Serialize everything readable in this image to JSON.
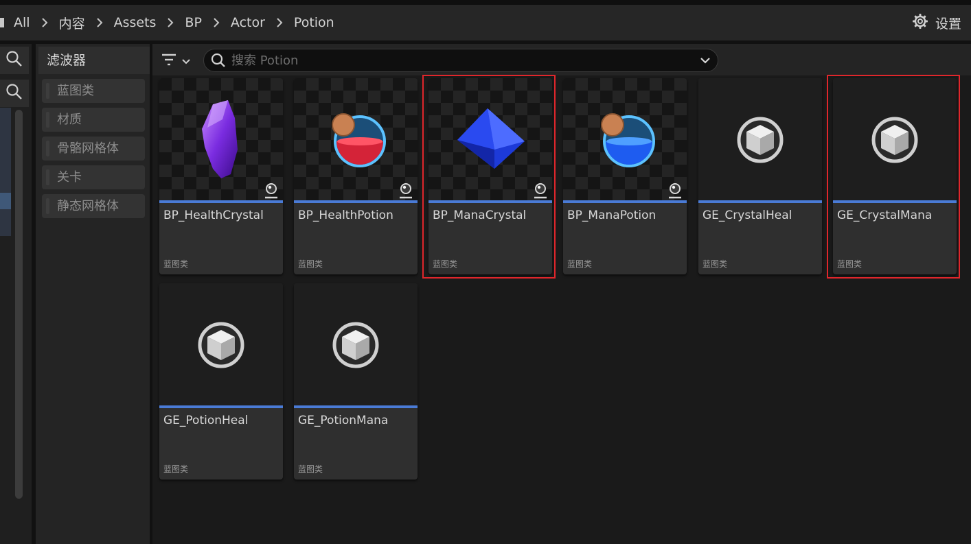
{
  "breadcrumb": {
    "items": [
      "All",
      "内容",
      "Assets",
      "BP",
      "Actor",
      "Potion"
    ],
    "settings_label": "设置"
  },
  "filters": {
    "title": "滤波器",
    "items": [
      "蓝图类",
      "材质",
      "骨骼网格体",
      "关卡",
      "静态网格体"
    ]
  },
  "search": {
    "placeholder": "搜索 Potion",
    "value": ""
  },
  "assets": [
    {
      "name": "BP_HealthCrystal",
      "type": "蓝图类",
      "thumb": "purple-crystal",
      "selected": false
    },
    {
      "name": "BP_HealthPotion",
      "type": "蓝图类",
      "thumb": "red-potion",
      "selected": false
    },
    {
      "name": "BP_ManaCrystal",
      "type": "蓝图类",
      "thumb": "blue-crystal",
      "selected": true
    },
    {
      "name": "BP_ManaPotion",
      "type": "蓝图类",
      "thumb": "blue-potion",
      "selected": false
    },
    {
      "name": "GE_CrystalHeal",
      "type": "蓝图类",
      "thumb": "cube-icon",
      "selected": false
    },
    {
      "name": "GE_CrystalMana",
      "type": "蓝图类",
      "thumb": "cube-icon",
      "selected": true
    },
    {
      "name": "GE_PotionHeal",
      "type": "蓝图类",
      "thumb": "cube-icon",
      "selected": false
    },
    {
      "name": "GE_PotionMana",
      "type": "蓝图类",
      "thumb": "cube-icon",
      "selected": false
    }
  ],
  "colors": {
    "accent": "#4a7bd6",
    "selection": "#e0262b"
  }
}
